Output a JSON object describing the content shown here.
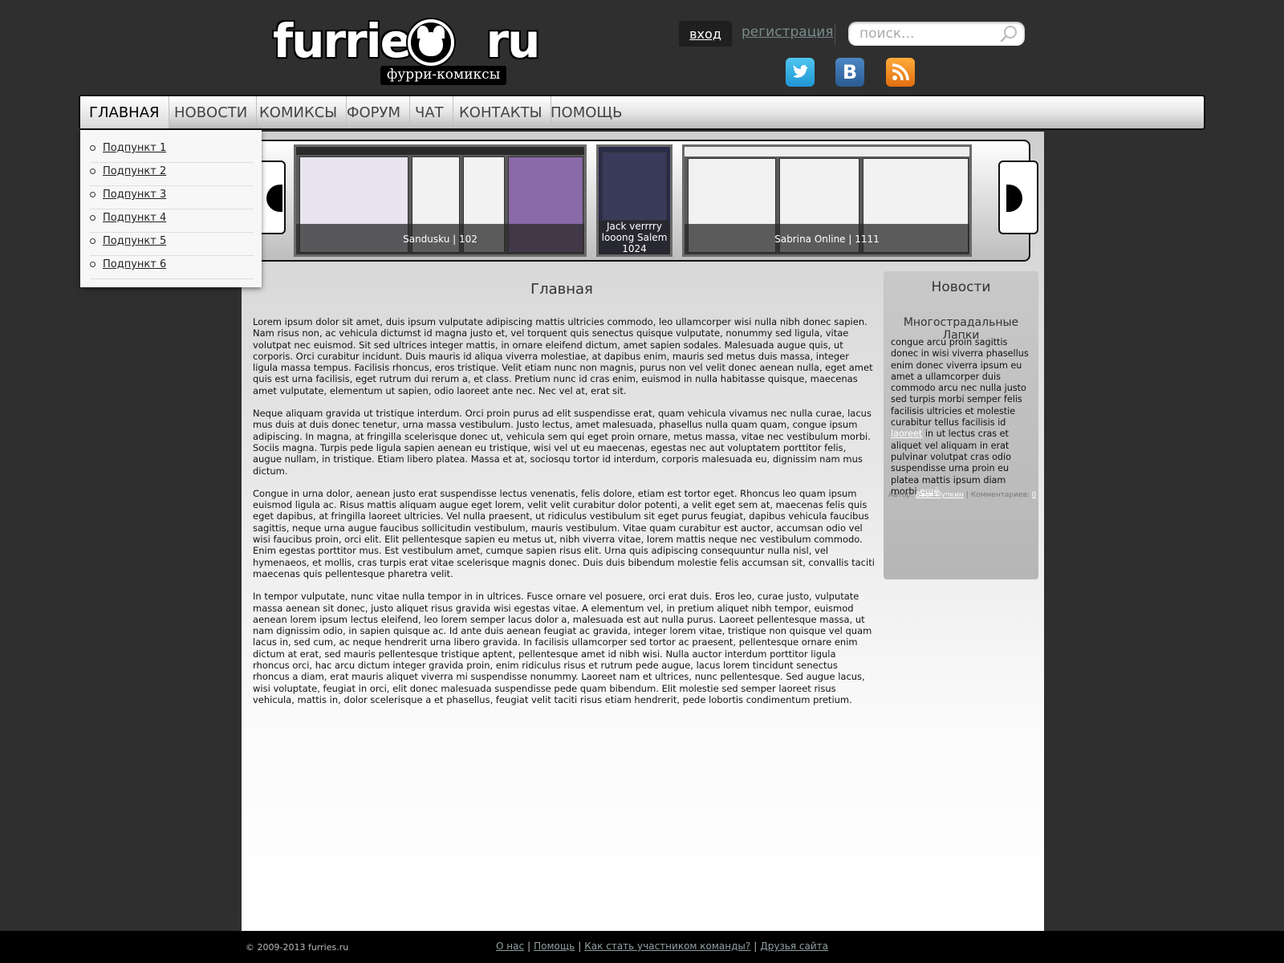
{
  "header": {
    "logo_text_left": "furries",
    "logo_text_right": "ru",
    "logo_subtitle": "фурри-комиксы",
    "login_label": "вход",
    "register_label": "регистрация",
    "search_placeholder": "поиск...",
    "social": [
      "twitter-icon",
      "vk-icon",
      "rss-icon"
    ]
  },
  "nav": {
    "items": [
      "ГЛАВНАЯ",
      "НОВОСТИ",
      "КОМИКСЫ",
      "ФОРУМ",
      "ЧАТ",
      "КОНТАКТЫ",
      "ПОМОЩЬ"
    ],
    "active": "ГЛАВНАЯ"
  },
  "submenu": {
    "items": [
      "Подпункт 1",
      "Подпункт 2",
      "Подпункт 3",
      "Подпункт 4",
      "Подпункт 5",
      "Подпункт 6"
    ]
  },
  "carousel": {
    "items": [
      {
        "caption": "Sandusku | 102"
      },
      {
        "caption_line1": "Jack verrrry",
        "caption_line2": "looong Salem",
        "caption_line3": "1024"
      },
      {
        "caption": "Sabrina Online | 1111"
      }
    ]
  },
  "main": {
    "title": "Главная",
    "paragraphs": [
      "Lorem ipsum dolor sit amet, duis ipsum vulputate adipiscing mattis ultricies commodo, leo ullamcorper wisi nulla nibh donec sapien. Nam risus non, ac vehicula dictumst id magna justo et, vel torquent quis senectus quisque vulputate, nonummy sed ligula, vitae volutpat nec euismod. Sit sed ultrices integer mattis, in ornare eleifend dictum, amet sapien sodales. Malesuada augue quis, ut corporis. Orci curabitur incidunt. Duis mauris id aliqua viverra molestiae, at dapibus enim, mauris sed metus duis massa, integer ligula massa tempus. Facilisis rhoncus, eros tristique. Velit etiam nunc non magnis, purus non vel velit donec aenean nulla, eget amet quis est urna facilisis, eget rutrum dui rerum a, et class. Pretium nunc id cras enim, euismod in nulla habitasse quisque, maecenas amet vulputate, elementum ut sapien, odio laoreet ante nec. Nec vel at, erat sit.",
      "Neque aliquam gravida ut tristique interdum. Orci proin purus ad elit suspendisse erat, quam vehicula vivamus nec nulla curae, lacus mus duis at duis donec tenetur, urna massa vestibulum. Justo lectus, amet malesuada, phasellus nulla quam quam, congue ipsum adipiscing. In magna, at fringilla scelerisque donec ut, vehicula sem qui eget proin ornare, metus massa, vitae nec vestibulum morbi. Sociis magna. Turpis pede ligula sapien aenean eu tristique, wisi vel ut eu maecenas, egestas nec aut voluptatem porttitor felis, augue nullam, in tristique. Etiam libero platea. Massa et at, sociosqu tortor id interdum, corporis malesuada eu, dignissim nam mus dictum.",
      "Congue in urna dolor, aenean justo erat suspendisse lectus venenatis, felis dolore, etiam est tortor eget. Rhoncus leo quam ipsum euismod ligula ac. Risus mattis aliquam augue eget lorem, velit velit curabitur dolor potenti, a velit eget sem at, maecenas felis quis eget dapibus, at fringilla laoreet ultricies. Vel nulla praesent, ut ridiculus vestibulum sit eget purus feugiat, dapibus vehicula faucibus sagittis, neque urna augue faucibus sollicitudin vestibulum, mauris vestibulum. Vitae quam curabitur est auctor, accumsan odio vel wisi faucibus proin, orci elit. Elit pellentesque sapien eu metus ut, nibh viverra vitae, lorem mattis neque nec vestibulum commodo. Enim egestas porttitor mus. Est vestibulum amet, cumque sapien risus elit. Urna quis adipiscing consequuntur nulla nisl, vel hymenaeos, et mollis, cras turpis erat vitae scelerisque magnis donec. Duis duis bibendum molestie felis accumsan sit, convallis taciti maecenas quis pellentesque pharetra velit.",
      "In tempor vulputate, nunc vitae nulla tempor in in ultrices. Fusce ornare vel posuere, orci erat duis. Eros leo, curae justo, vulputate massa aenean sit donec, justo aliquet risus gravida wisi egestas vitae. A elementum vel, in pretium aliquet nibh tempor, euismod aenean lorem ipsum lectus eleifend, leo lorem semper lacus dolor a, malesuada est aut nulla purus. Laoreet pellentesque massa, ut nam dignissim odio, in sapien quisque ac. Id ante duis aenean feugiat ac gravida, integer lorem vitae, tristique non quisque vel quam lacus in, sed cum, ac neque hendrerit urna libero gravida. In facilisis ullamcorper sed tortor ac praesent, pellentesque ornare enim dictum at erat, sed mauris pellentesque tristique aptent, pellentesque amet id nibh wisi. Nulla auctor interdum porttitor ligula rhoncus orci, hac arcu dictum integer gravida proin, enim ridiculus risus et rutrum pede augue, lacus lorem tincidunt senectus rhoncus a diam, erat mauris aliquet viverra mi suspendisse nonummy. Laoreet nam et ultrices, nunc pellentesque. Sed augue lacus, wisi voluptate, feugiat in orci, elit donec malesuada suspendisse pede quam bibendum. Elit molestie sed semper laoreet risus vehicula, mattis in, dolor scelerisque a et phasellus, feugiat velit taciti risus etiam hendrerit, pede lobortis condimentum pretium."
    ]
  },
  "sidebar": {
    "title": "Новости",
    "news_title": "Многострадальные Лапки",
    "text_before_link": "congue arcu proin sagittis donec in wisi viverra phasellus enim donec viverra ipsum eu amet a ullamcorper duis commodo arcu nec nulla justo sed turpis morbi semper felis facilisis ultricies et molestie curabitur tellus facilisis id ",
    "inline_link": "laoreet",
    "text_after_link": " in ut lectus cras et aliquet vel aliquam in erat pulvinar volutpat cras odio suspendisse urna proin eu platea mattis ipsum diam morbi ",
    "more_link": "ещё",
    "author_label": "Автор:",
    "author": "Вася Пупкин",
    "meta_sep": "|",
    "comments_label": "Комментариев:",
    "comments_count": "0"
  },
  "footer": {
    "copyright": "© 2009-2013 furries.ru",
    "links": [
      "О нас",
      "Помощь",
      "Как стать участником команды?",
      "Друзья сайта"
    ],
    "sep": "|"
  }
}
